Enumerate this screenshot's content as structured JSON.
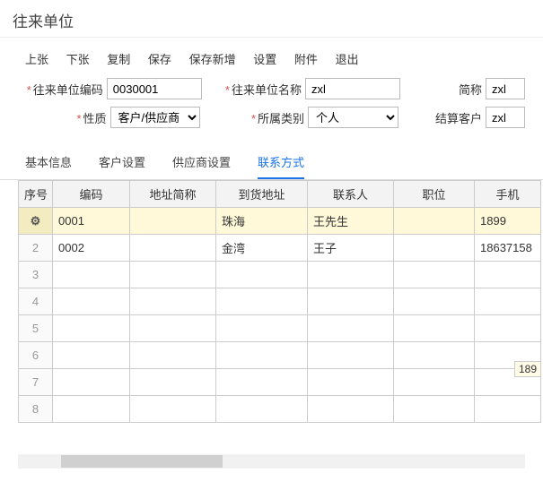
{
  "header": {
    "title": "往来单位"
  },
  "toolbar": {
    "prev": "上张",
    "next": "下张",
    "copy": "复制",
    "save": "保存",
    "save_new": "保存新增",
    "settings": "设置",
    "attach": "附件",
    "exit": "退出"
  },
  "form": {
    "unit_code_label": "往来单位编码",
    "unit_code_value": "0030001",
    "unit_name_label": "往来单位名称",
    "unit_name_value": "zxl",
    "short_label": "简称",
    "short_value": "zxl",
    "nature_label": "性质",
    "nature_value": "客户/供应商",
    "category_label": "所属类别",
    "category_value": "个人",
    "settle_label": "结算客户",
    "settle_value": "zxl"
  },
  "tabs": {
    "t1": "基本信息",
    "t2": "客户设置",
    "t3": "供应商设置",
    "t4": "联系方式"
  },
  "table": {
    "headers": {
      "seq": "序号",
      "code": "编码",
      "addr_short": "地址简称",
      "delivery": "到货地址",
      "contact": "联系人",
      "title": "职位",
      "phone": "手机"
    },
    "rows": [
      {
        "seq": "⚙",
        "code": "0001",
        "addr_short": "",
        "delivery": "珠海",
        "contact": "王先生",
        "title": "",
        "phone": "1899"
      },
      {
        "seq": "2",
        "code": "0002",
        "addr_short": "",
        "delivery": "金湾",
        "contact": "王子",
        "title": "",
        "phone": "18637158"
      }
    ],
    "empty_seq": [
      "3",
      "4",
      "5",
      "6",
      "7",
      "8"
    ],
    "phone_tip": "189"
  }
}
